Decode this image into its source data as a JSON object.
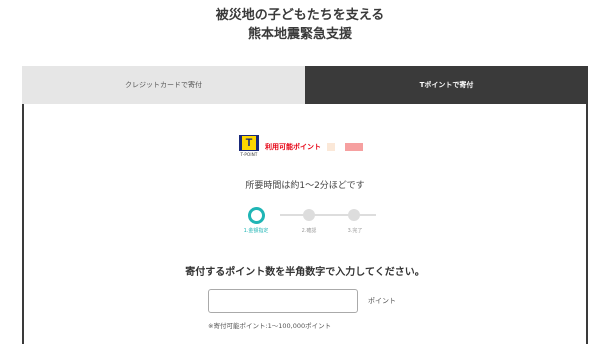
{
  "header": {
    "title_line1": "被災地の子どもたちを支える",
    "title_line2": "熊本地震緊急支援"
  },
  "tabs": [
    {
      "label": "クレジットカードで寄付",
      "active": false
    },
    {
      "label": "Tポイントで寄付",
      "active": true
    }
  ],
  "points": {
    "logo_letter": "T",
    "logo_text": "T-POINT",
    "available_label": "利用可能ポイント"
  },
  "duration_text": "所要時間は約1～2分ほどです",
  "steps": [
    {
      "label": "1.金額指定",
      "current": true
    },
    {
      "label": "2.確認",
      "current": false
    },
    {
      "label": "3.完了",
      "current": false
    }
  ],
  "form": {
    "instruction": "寄付するポイント数を半角数字で入力してください。",
    "input_value": "",
    "unit_label": "ポイント",
    "note": "※寄付可能ポイント:1～100,000ポイント"
  },
  "colors": {
    "accent": "#1fb5b5",
    "dark": "#3a3a3a",
    "points_red": "#e60012"
  }
}
